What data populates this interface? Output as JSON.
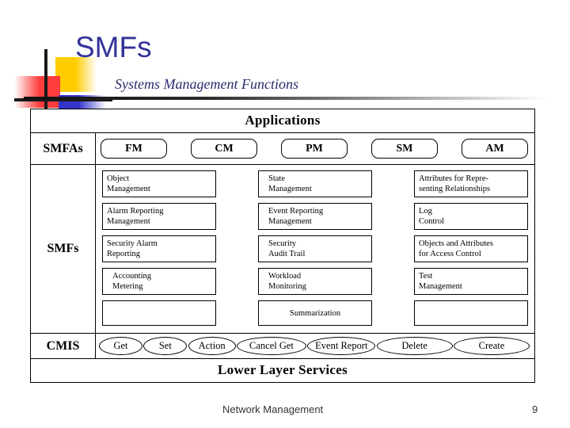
{
  "slide": {
    "title": "SMFs",
    "subtitle": "Systems Management Functions",
    "title_color": "#333399"
  },
  "ornament": {
    "yellow": "#FFCC00",
    "red": "#FF3B3B",
    "blue": "#3333CC",
    "cross": "#1a1a1a"
  },
  "diagram": {
    "top_band": "Applications",
    "bottom_band": "Lower Layer Services",
    "rows": {
      "smfas": {
        "label": "SMFAs",
        "items": [
          "FM",
          "CM",
          "PM",
          "SM",
          "AM"
        ]
      },
      "smfs": {
        "label": "SMFs",
        "grid": [
          [
            "Object\nManagement",
            "State\nManagement",
            "Attributes for Repre-\nsenting Relationships"
          ],
          [
            "Alarm Reporting\nManagement",
            "Event Reporting\nManagement",
            "Log\nControl"
          ],
          [
            "Security Alarm\nReporting",
            "Security\nAudit Trail",
            "Objects and Attributes\nfor Access Control"
          ],
          [
            "Accounting\nMetering",
            "Workload\nMonitoring",
            "Test\nManagement"
          ],
          [
            "",
            "Summarization",
            ""
          ]
        ],
        "r0c0": "Object\nManagement",
        "r0c1": "State\nManagement",
        "r0c2": "Attributes for Repre-\nsenting Relationships",
        "r1c0": "Alarm Reporting\nManagement",
        "r1c1": "Event Reporting\nManagement",
        "r1c2": "Log\nControl",
        "r2c0": "Security Alarm\nReporting",
        "r2c1": "Security\nAudit Trail",
        "r2c2": "Objects and Attributes\nfor Access Control",
        "r3c0": "Accounting\nMetering",
        "r3c1": "Workload\nMonitoring",
        "r3c2": "Test\nManagement",
        "r4c0": "",
        "r4c1": "Summarization",
        "r4c2": ""
      },
      "cmis": {
        "label": "CMIS",
        "operations": [
          "Get",
          "Set",
          "Action",
          "Cancel Get",
          "Event Report",
          "Delete",
          "Create"
        ]
      }
    }
  },
  "footer": {
    "text": "Network Management",
    "page_number": "9"
  }
}
